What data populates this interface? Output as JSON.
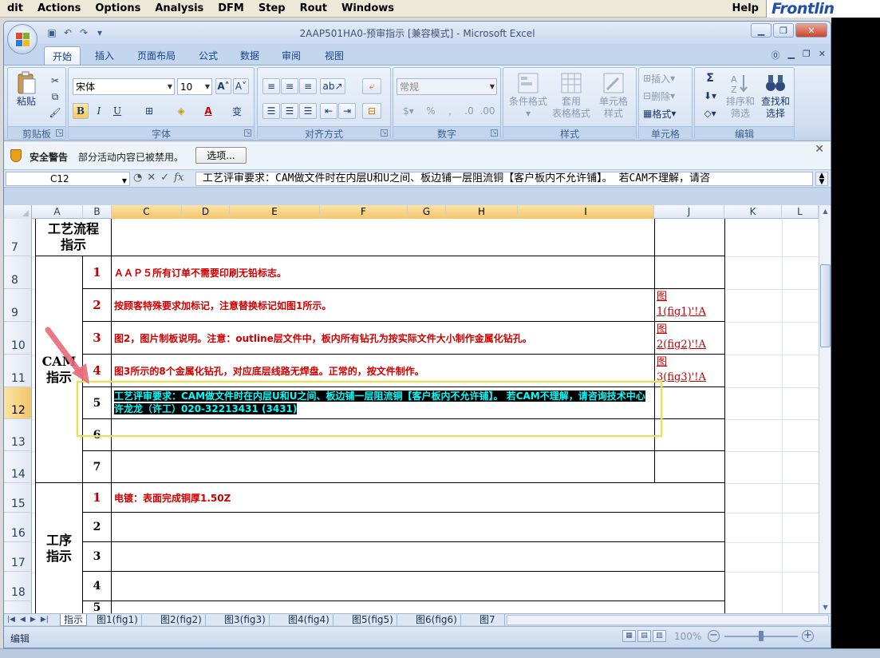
{
  "background_app": {
    "menus": [
      "dit",
      "Actions",
      "Options",
      "Analysis",
      "DFM",
      "Step",
      "Rout",
      "Windows"
    ],
    "help": "Help",
    "logo": "Frontlin"
  },
  "window": {
    "title": "2AAP501HA0-预审指示 [兼容模式] - Microsoft Excel"
  },
  "ribbon": {
    "tabs": [
      "开始",
      "插入",
      "页面布局",
      "公式",
      "数据",
      "审阅",
      "视图"
    ],
    "active_tab": "开始",
    "clipboard": {
      "label": "剪贴板",
      "paste": "粘贴"
    },
    "font": {
      "label": "字体",
      "name": "宋体",
      "size": "10",
      "bold": "B",
      "italic": "I",
      "underline": "U"
    },
    "alignment": {
      "label": "对齐方式"
    },
    "number": {
      "label": "数字",
      "format": "常规",
      "percent": "%"
    },
    "styles": {
      "label": "样式",
      "conditional": "条件格式",
      "table_format": "套用\n表格格式",
      "cell_styles": "单元格\n样式"
    },
    "cells": {
      "label": "单元格",
      "insert": "插入",
      "delete": "删除",
      "format": "格式"
    },
    "editing": {
      "label": "编辑",
      "sum": "Σ",
      "sort": "排序和\n筛选",
      "find": "查找和\n选择"
    }
  },
  "security_bar": {
    "title": "安全警告",
    "message": "部分活动内容已被禁用。",
    "options_button": "选项..."
  },
  "formula_bar": {
    "name_box": "C12",
    "fx": "fx",
    "content": "工艺评审要求：CAM做文件时在内层U和U之间、板边铺一层阻流铜【客户板内不允许铺】。 若CAM不理解，请咨"
  },
  "sheet": {
    "columns": [
      "A",
      "B",
      "C",
      "D",
      "E",
      "F",
      "G",
      "H",
      "I",
      "J",
      "K",
      "L"
    ],
    "selected_column": "C",
    "rows": [
      "7",
      "8",
      "9",
      "10",
      "11",
      "12",
      "13",
      "14",
      "15",
      "16",
      "17",
      "18"
    ],
    "selected_row": "12",
    "sections": {
      "process": "工艺流程\n指示",
      "cam": "CAM\n指示",
      "procedure": "工序\n指示"
    },
    "cam_items": [
      {
        "num": "1",
        "text": "ＡＡＰ５所有订单不需要印刷无铅标志。"
      },
      {
        "num": "2",
        "text": "按顾客特殊要求加标记，注意替换标记如图1所示。"
      },
      {
        "num": "3",
        "text": "图2，图片制板说明。注意：outline层文件中，板内所有钻孔为按实际文件大小制作金属化钻孔。"
      },
      {
        "num": "4",
        "text": "图3所示的8个金属化钻孔，对应底层线路无焊盘。正常的，按文件制作。"
      },
      {
        "num": "5",
        "text": "工艺评审要求：CAM做文件时在内层U和U之间、板边铺一层阻流铜【客户板内不允许铺】。 若CAM不理解，请咨询技术中心 许龙龙（许工）020-32213431 (3431)"
      },
      {
        "num": "6",
        "text": ""
      },
      {
        "num": "7",
        "text": ""
      }
    ],
    "links": [
      "图\n1(fig1)'!A",
      "图\n2(fig2)'!A",
      "图\n3(fig3)'!A"
    ],
    "procedure_items": [
      {
        "num": "1",
        "text": "电镀：表面完成铜厚1.50Z"
      },
      {
        "num": "2",
        "text": ""
      },
      {
        "num": "3",
        "text": ""
      },
      {
        "num": "4",
        "text": ""
      },
      {
        "num": "5",
        "text": ""
      }
    ]
  },
  "sheet_tabs": [
    "指示",
    "图1(fig1)",
    "图2(fig2)",
    "图3(fig3)",
    "图4(fig4)",
    "图5(fig5)",
    "图6(fig6)",
    "图7"
  ],
  "status": {
    "mode": "编辑",
    "zoom": "100%"
  }
}
